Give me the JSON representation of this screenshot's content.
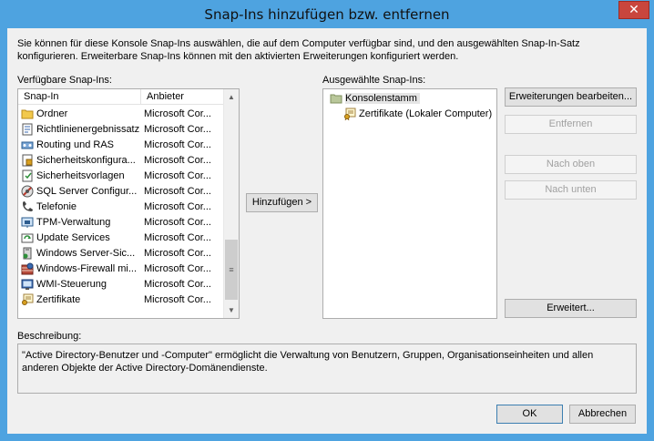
{
  "window": {
    "title": "Snap-Ins hinzufügen bzw. entfernen"
  },
  "intro_text": "Sie können für diese Konsole Snap-Ins auswählen, die auf dem Computer verfügbar sind, und den ausgewählten Snap-In-Satz konfigurieren. Erweiterbare Snap-Ins können mit den aktivierten Erweiterungen konfiguriert werden.",
  "available": {
    "label": "Verfügbare Snap-Ins:",
    "columns": [
      "Snap-In",
      "Anbieter"
    ],
    "rows": [
      {
        "name": "Ordner",
        "vendor": "Microsoft Cor...",
        "icon": "folder-icon"
      },
      {
        "name": "Richtlinienergebnissatz",
        "vendor": "Microsoft Cor...",
        "icon": "policy-document-icon"
      },
      {
        "name": "Routing und RAS",
        "vendor": "Microsoft Cor...",
        "icon": "routing-icon"
      },
      {
        "name": "Sicherheitskonfigura...",
        "vendor": "Microsoft Cor...",
        "icon": "security-config-icon"
      },
      {
        "name": "Sicherheitsvorlagen",
        "vendor": "Microsoft Cor...",
        "icon": "security-template-icon"
      },
      {
        "name": "SQL Server Configur...",
        "vendor": "Microsoft Cor...",
        "icon": "sql-server-icon"
      },
      {
        "name": "Telefonie",
        "vendor": "Microsoft Cor...",
        "icon": "telephone-icon"
      },
      {
        "name": "TPM-Verwaltung",
        "vendor": "Microsoft Cor...",
        "icon": "tpm-icon"
      },
      {
        "name": "Update Services",
        "vendor": "Microsoft Cor...",
        "icon": "update-services-icon"
      },
      {
        "name": "Windows Server-Sic...",
        "vendor": "Microsoft Cor...",
        "icon": "server-backup-icon"
      },
      {
        "name": "Windows-Firewall mi...",
        "vendor": "Microsoft Cor...",
        "icon": "firewall-icon"
      },
      {
        "name": "WMI-Steuerung",
        "vendor": "Microsoft Cor...",
        "icon": "wmi-icon"
      },
      {
        "name": "Zertifikate",
        "vendor": "Microsoft Cor...",
        "icon": "certificate-icon"
      }
    ]
  },
  "add_button": "Hinzufügen >",
  "selected": {
    "label": "Ausgewählte Snap-Ins:",
    "root": "Konsolenstamm",
    "child": "Zertifikate (Lokaler Computer)"
  },
  "buttons": {
    "edit_extensions": "Erweiterungen bearbeiten...",
    "remove": "Entfernen",
    "move_up": "Nach oben",
    "move_down": "Nach unten",
    "advanced": "Erweitert...",
    "ok": "OK",
    "cancel": "Abbrechen"
  },
  "description": {
    "label": "Beschreibung:",
    "text": "\"Active Directory-Benutzer und -Computer\" ermöglicht die Verwaltung von Benutzern, Gruppen, Organisationseinheiten und allen anderen Objekte der Active Directory-Domänendienste."
  },
  "colors": {
    "frame": "#4ea3e0",
    "close": "#c9463d",
    "dialog": "#f0f0f0"
  }
}
